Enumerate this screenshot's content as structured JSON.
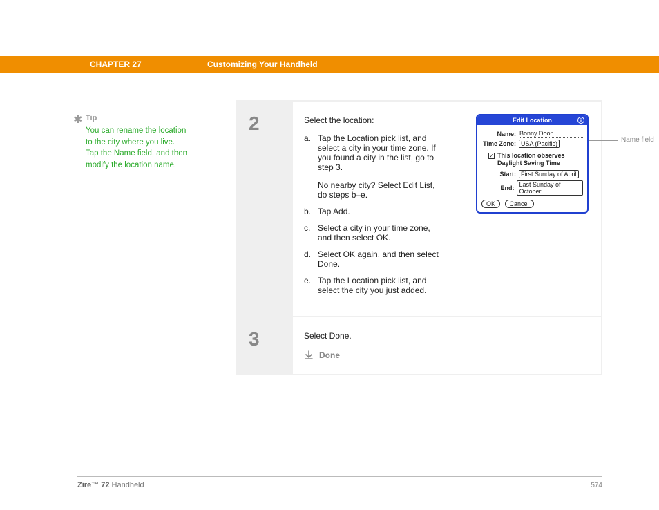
{
  "header": {
    "chapter": "CHAPTER 27",
    "title": "Customizing Your Handheld"
  },
  "tip": {
    "label": "Tip",
    "body": "You can rename the location to the city where you live. Tap the Name field, and then modify the location name."
  },
  "steps": {
    "s2": {
      "num": "2",
      "intro": "Select the location:",
      "a": {
        "letter": "a.",
        "text": "Tap the Location pick list, and select a city in your time zone. If you found a city in the list, go to step 3.",
        "sub": "No nearby city? Select Edit List, do steps b–e."
      },
      "b": {
        "letter": "b.",
        "text": "Tap Add."
      },
      "c": {
        "letter": "c.",
        "text": "Select a city in your time zone, and then select OK."
      },
      "d": {
        "letter": "d.",
        "text": "Select OK again, and then select Done."
      },
      "e": {
        "letter": "e.",
        "text": "Tap the Location pick list, and select the city you just added."
      }
    },
    "s3": {
      "num": "3",
      "text": "Select Done.",
      "done": "Done"
    }
  },
  "dialog": {
    "title": "Edit Location",
    "name_label": "Name:",
    "name_value": "Bonny Doon",
    "tz_label": "Time Zone:",
    "tz_value": "USA (Pacific)",
    "dst_text": "This location observes Daylight Saving Time",
    "start_label": "Start:",
    "start_value": "First Sunday of April",
    "end_label": "End:",
    "end_value": "Last Sunday of October",
    "ok": "OK",
    "cancel": "Cancel",
    "checkmark": "✓",
    "info": "i"
  },
  "callout": {
    "name_field": "Name field"
  },
  "footer": {
    "product_b": "Zire™ 72",
    "product_r": " Handheld",
    "page": "574"
  }
}
